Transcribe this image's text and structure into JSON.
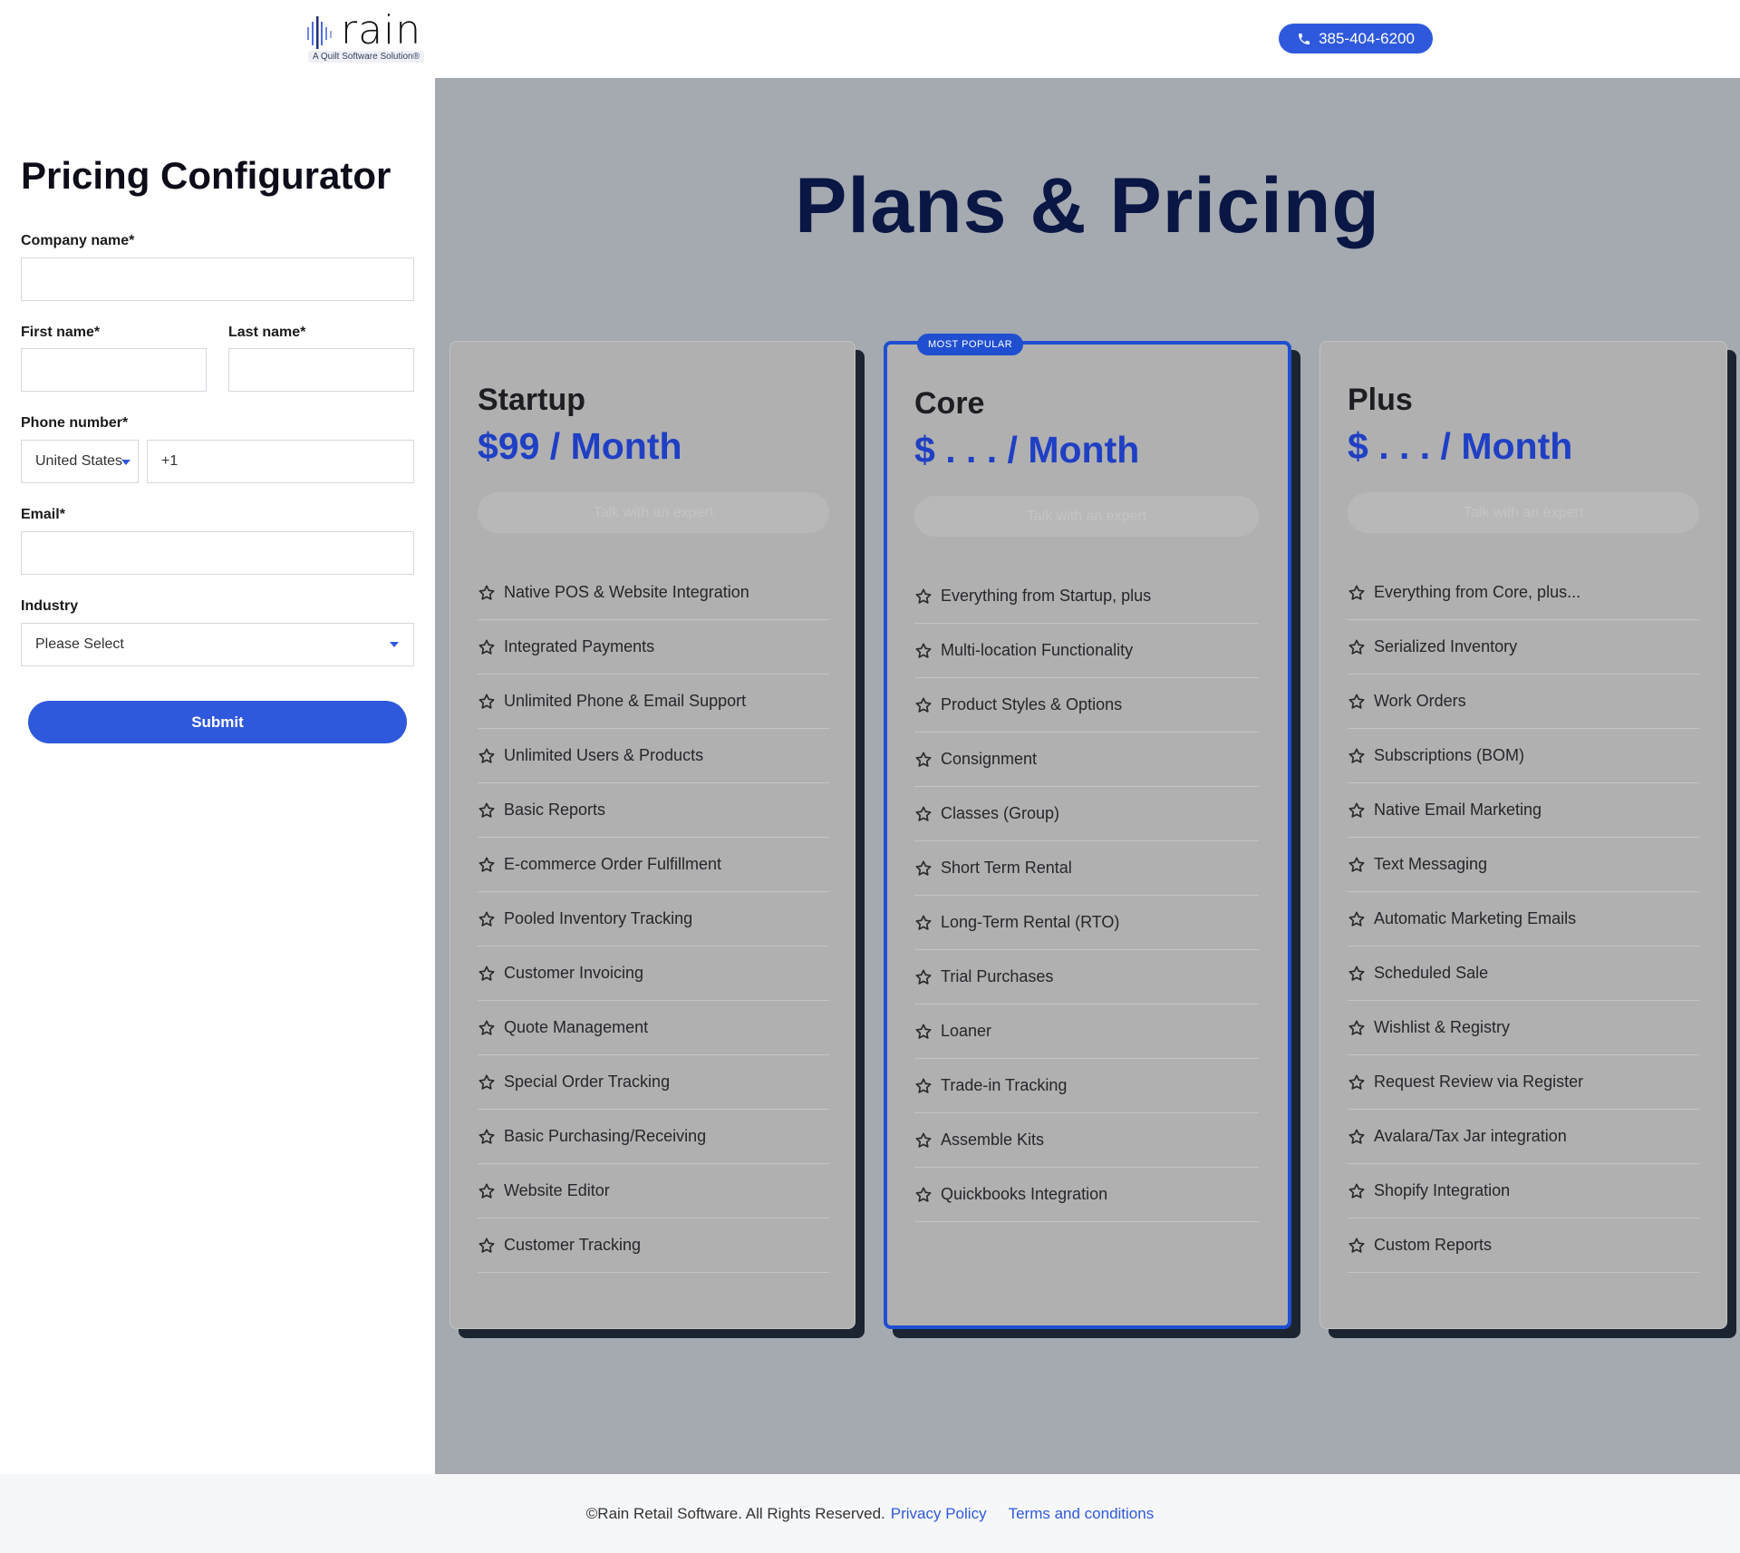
{
  "header": {
    "logo_word": "rain",
    "logo_tagline": "A Quilt Software Solution®",
    "phone": "385-404-6200"
  },
  "form": {
    "title": "Pricing Configurator",
    "company_label": "Company name*",
    "company_value": "",
    "first_name_label": "First name*",
    "first_name_value": "",
    "last_name_label": "Last name*",
    "last_name_value": "",
    "phone_label": "Phone number*",
    "country_value": "United States",
    "phone_value": "+1",
    "email_label": "Email*",
    "email_value": "",
    "industry_label": "Industry",
    "industry_value": "Please Select",
    "submit_label": "Submit"
  },
  "pricing": {
    "title": "Plans & Pricing",
    "plans": [
      {
        "name": "Startup",
        "price": "$99 / Month",
        "cta": "Talk with an expert",
        "features": [
          "Native POS & Website Integration",
          "Integrated Payments",
          "Unlimited Phone & Email Support",
          "Unlimited Users & Products",
          "Basic Reports",
          "E-commerce Order Fulfillment",
          "Pooled Inventory Tracking",
          "Customer Invoicing",
          "Quote Management",
          "Special Order Tracking",
          "Basic Purchasing/Receiving",
          "Website Editor",
          "Customer Tracking"
        ]
      },
      {
        "name": "Core",
        "badge": "MOST POPULAR",
        "price": "$ . . . / Month",
        "cta": "Talk with an expert",
        "features": [
          "Everything from Startup, plus",
          "Multi-location Functionality",
          "Product Styles & Options",
          "Consignment",
          "Classes (Group)",
          "Short Term Rental",
          "Long-Term Rental (RTO)",
          "Trial Purchases",
          "Loaner",
          "Trade-in Tracking",
          "Assemble Kits",
          "Quickbooks Integration"
        ]
      },
      {
        "name": "Plus",
        "price": "$ . . . / Month",
        "cta": "Talk with an expert",
        "features": [
          "Everything from Core, plus...",
          "Serialized Inventory",
          "Work Orders",
          "Subscriptions (BOM)",
          "Native Email Marketing",
          "Text Messaging",
          "Automatic Marketing Emails",
          "Scheduled Sale",
          "Wishlist & Registry",
          "Request Review via Register",
          "Avalara/Tax Jar integration",
          "Shopify Integration",
          "Custom Reports"
        ]
      }
    ]
  },
  "footer": {
    "copyright": "©Rain Retail Software. All Rights Reserved.",
    "privacy": "Privacy Policy",
    "terms": "Terms and conditions"
  },
  "colors": {
    "accent": "#2f59dc",
    "pricing_bg": "#a5aab1",
    "title_navy": "#0a1744",
    "price_blue": "#1f3fc4"
  }
}
